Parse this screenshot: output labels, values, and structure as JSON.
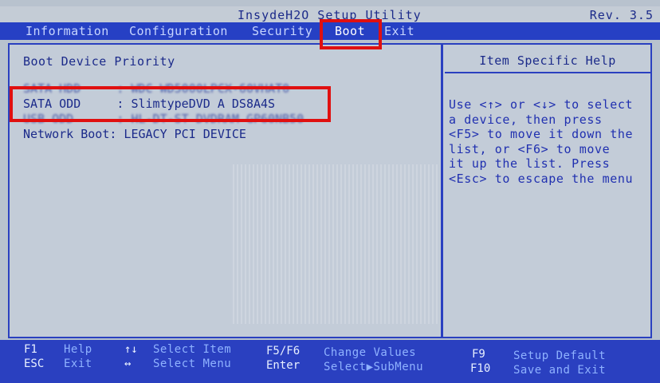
{
  "title_bar": {
    "title": "InsydeH2O Setup Utility",
    "revision": "Rev. 3.5"
  },
  "menu": {
    "items": [
      {
        "label": "Information"
      },
      {
        "label": "Configuration"
      },
      {
        "label": "Security"
      },
      {
        "label": "Boot"
      },
      {
        "label": "Exit"
      }
    ],
    "active": "Boot"
  },
  "boot": {
    "section_title": "Boot Device Priority",
    "items": [
      {
        "label": "SATA HDD     : WDC WD5000LPCX-60VHAT0"
      },
      {
        "label": "SATA ODD     : SlimtypeDVD A DS8A4S"
      },
      {
        "label": "USB ODD      : HL-DT-ST DVDRAM GP60NB50"
      },
      {
        "label": "Network Boot: LEGACY PCI DEVICE"
      }
    ]
  },
  "help": {
    "title": "Item Specific Help",
    "lines": [
      "Use <↑> or <↓> to select",
      "a device, then press",
      "<F5> to move it down the",
      "list, or <F6> to move",
      "it up the list. Press",
      "<Esc> to escape the menu"
    ]
  },
  "footer": {
    "keys": [
      {
        "key": "F1",
        "desc": "Help"
      },
      {
        "key": "ESC",
        "desc": "Exit"
      },
      {
        "key": "↑↓",
        "desc": "Select Item"
      },
      {
        "key": "↔",
        "desc": "Select Menu"
      },
      {
        "key": "F5/F6",
        "desc": "Change Values"
      },
      {
        "key": "Enter",
        "desc": "Select▶SubMenu"
      },
      {
        "key": "F9",
        "desc": "Setup Default"
      },
      {
        "key": "F10",
        "desc": "Save and Exit"
      }
    ]
  },
  "colors": {
    "highlight_box": "#e01010",
    "menu_bar": "#2640c4",
    "panel_bg": "#c3ccd8"
  }
}
